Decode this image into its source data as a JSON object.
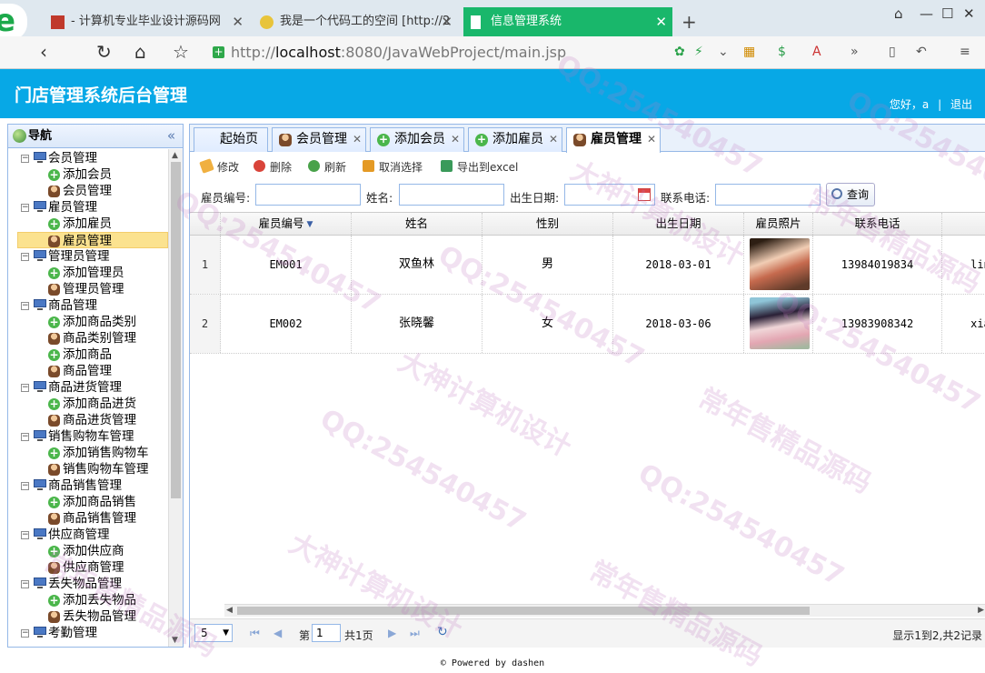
{
  "browser": {
    "tabs": [
      {
        "label": "- 计算机专业毕业设计源码网"
      },
      {
        "label": "我是一个代码工的空间 [http://2"
      },
      {
        "label": "信息管理系统"
      }
    ],
    "url": {
      "scheme": "http://",
      "host": "localhost",
      "rest": ":8080/JavaWebProject/main.jsp"
    }
  },
  "header": {
    "title": "门店管理系统后台管理",
    "greeting": "您好，a",
    "logout": "退出"
  },
  "nav": {
    "title": "导航",
    "groups": [
      {
        "label": "会员管理",
        "items": [
          "添加会员",
          "会员管理"
        ]
      },
      {
        "label": "雇员管理",
        "items": [
          "添加雇员",
          "雇员管理"
        ]
      },
      {
        "label": "管理员管理",
        "items": [
          "添加管理员",
          "管理员管理"
        ]
      },
      {
        "label": "商品管理",
        "items": [
          "添加商品类别",
          "商品类别管理",
          "添加商品",
          "商品管理"
        ]
      },
      {
        "label": "商品进货管理",
        "items": [
          "添加商品进货",
          "商品进货管理"
        ]
      },
      {
        "label": "销售购物车管理",
        "items": [
          "添加销售购物车",
          "销售购物车管理"
        ]
      },
      {
        "label": "商品销售管理",
        "items": [
          "添加商品销售",
          "商品销售管理"
        ]
      },
      {
        "label": "供应商管理",
        "items": [
          "添加供应商",
          "供应商管理"
        ]
      },
      {
        "label": "丢失物品管理",
        "items": [
          "添加丢失物品",
          "丢失物品管理"
        ]
      },
      {
        "label": "考勤管理",
        "items": []
      }
    ]
  },
  "content_tabs": [
    "起始页",
    "会员管理",
    "添加会员",
    "添加雇员",
    "雇员管理"
  ],
  "toolbar": {
    "edit": "修改",
    "delete": "删除",
    "refresh": "刷新",
    "cancel_select": "取消选择",
    "export": "导出到excel"
  },
  "search": {
    "emp_no_label": "雇员编号:",
    "name_label": "姓名:",
    "birth_label": "出生日期:",
    "phone_label": "联系电话:",
    "query_btn": "查询"
  },
  "grid": {
    "columns": [
      "雇员编号",
      "姓名",
      "性别",
      "出生日期",
      "雇员照片",
      "联系电话"
    ],
    "rows": [
      {
        "num": "1",
        "emp_no": "EM001",
        "name": "双鱼林",
        "sex": "男",
        "birth": "2018-03-01",
        "phone": "13984019834",
        "extra": "ling"
      },
      {
        "num": "2",
        "emp_no": "EM002",
        "name": "张晓馨",
        "sex": "女",
        "birth": "2018-03-06",
        "phone": "13983908342",
        "extra": "xiao"
      }
    ]
  },
  "pager": {
    "page_size": "5",
    "page_prefix": "第",
    "page_value": "1",
    "page_suffix": "共1页",
    "info": "显示1到2,共2记录"
  },
  "footer": "© Powered by dashen",
  "watermarks": [
    "QQ:254540457",
    "大神计算机设计",
    "常年售精品源码"
  ]
}
